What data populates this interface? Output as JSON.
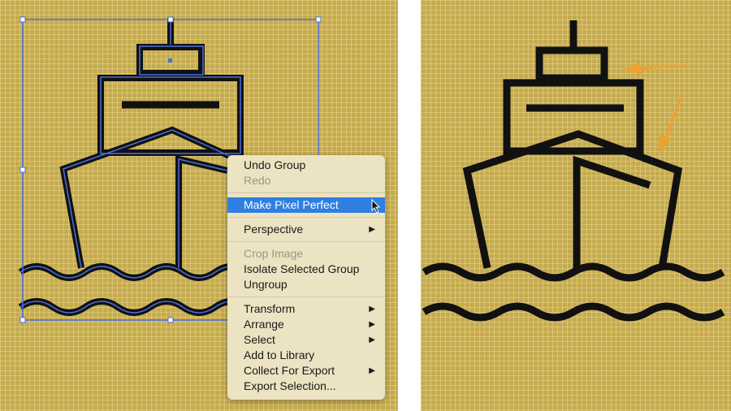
{
  "context_menu": {
    "groups": [
      [
        {
          "label": "Undo Group",
          "enabled": true
        },
        {
          "label": "Redo",
          "enabled": false
        }
      ],
      [
        {
          "label": "Make Pixel Perfect",
          "enabled": true,
          "highlighted": true
        }
      ],
      [
        {
          "label": "Perspective",
          "enabled": true,
          "submenu": true
        }
      ],
      [
        {
          "label": "Crop Image",
          "enabled": false
        },
        {
          "label": "Isolate Selected Group",
          "enabled": true
        },
        {
          "label": "Ungroup",
          "enabled": true
        }
      ],
      [
        {
          "label": "Transform",
          "enabled": true,
          "submenu": true
        },
        {
          "label": "Arrange",
          "enabled": true,
          "submenu": true
        },
        {
          "label": "Select",
          "enabled": true,
          "submenu": true
        },
        {
          "label": "Add to Library",
          "enabled": true
        },
        {
          "label": "Collect For Export",
          "enabled": true,
          "submenu": true
        },
        {
          "label": "Export Selection...",
          "enabled": true
        }
      ]
    ],
    "submenu_arrow": "▶"
  },
  "colors": {
    "canvas": "#c6ab4e",
    "highlight": "#2f7fe3",
    "selection": "#4a6ee0",
    "arrow": "#f0a030"
  }
}
